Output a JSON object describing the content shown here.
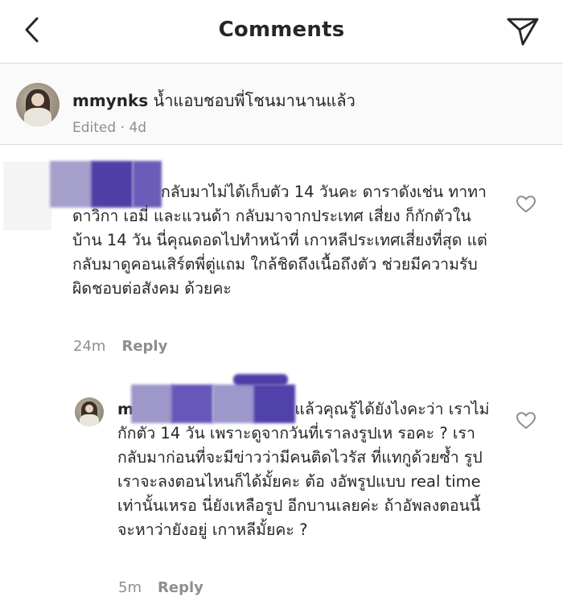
{
  "header": {
    "title": "Comments",
    "back_icon": "chevron-left-icon",
    "send_icon": "paper-plane-icon"
  },
  "caption": {
    "username": "mmynks",
    "text": "น้ำแอบชอบพี่โชนมานานแล้ว",
    "meta": "Edited · 4d"
  },
  "comments": [
    {
      "body": "กลับมาไม่ได้เก็บตัว 14 วันคะ ดาราดังเช่น ทาทา ดาวิกา เอมี่ และแวนด้า กลับมาจากประเทศ เสี่ยง ก็กักตัวในบ้าน 14 วัน นี่คุณดอดไปทำหน้าที่ เกาหลีประเทศเสี่ยงที่สุด แต่กลับมาดูคอนเสิร์ตพี่ตู่แถม ใกล้ชิดถึงเนื้อถึงตัว ช่วยมีความรับผิดชอบต่อสังคม ด้วยคะ",
      "time": "24m",
      "reply": "Reply"
    },
    {
      "username": "m",
      "body": "แล้วคุณรู้ได้ยังไงคะว่า เราไม่กักตัว 14 วัน เพราะดูจากวันที่เราลงรูปเห รอคะ ? เรากลับมาก่อนที่จะมีข่าวว่ามีคนติดไวรัส ที่แทกูด้วยซ้ำ รูปเราจะลงตอนไหนก็ได้มั้ยคะ ต้อ งอัพรูปแบบ real time เท่านั้นเหรอ นี่ยังเหลือรูป อีกบานเลยค่ะ ถ้าอัพลงตอนนี้จะหาว่ายังอยู่ เกาหลีมั้ยคะ ?",
      "time": "5m",
      "reply": "Reply"
    }
  ],
  "colors": {
    "text": "#262626",
    "meta": "#8e8e8e",
    "divider": "#dbdbdb",
    "redact_light": "#a39ec9",
    "redact_dark": "#4e3fa8"
  }
}
